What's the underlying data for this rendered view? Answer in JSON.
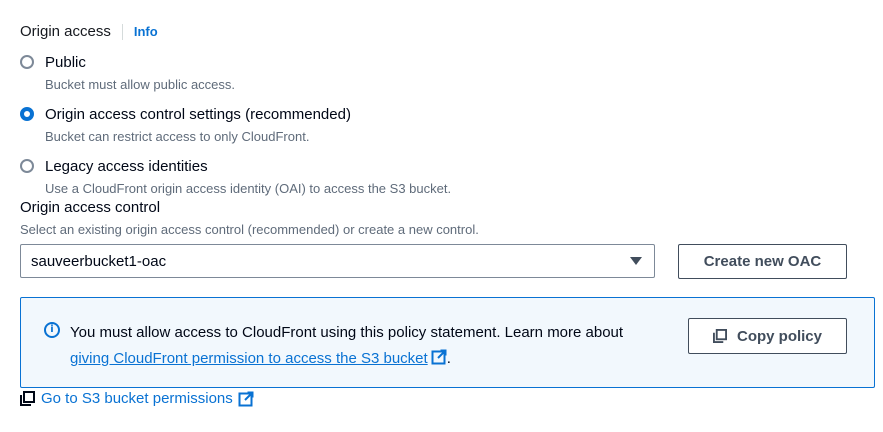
{
  "origin_access": {
    "title": "Origin access",
    "info_label": "Info",
    "options": [
      {
        "label": "Public",
        "description": "Bucket must allow public access.",
        "checked": false
      },
      {
        "label": "Origin access control settings (recommended)",
        "description": "Bucket can restrict access to only CloudFront.",
        "checked": true
      },
      {
        "label": "Legacy access identities",
        "description": "Use a CloudFront origin access identity (OAI) to access the S3 bucket.",
        "checked": false
      }
    ]
  },
  "origin_access_control": {
    "label": "Origin access control",
    "description": "Select an existing origin access control (recommended) or create a new control.",
    "selected_value": "sauveerbucket1-oac",
    "create_button_label": "Create new OAC"
  },
  "policy_alert": {
    "message": "You must allow access to CloudFront using this policy statement. Learn more about",
    "link_text": "giving CloudFront permission to access the S3 bucket",
    "trailing": ".",
    "copy_button_label": "Copy policy"
  },
  "permissions_link": {
    "label": "Go to S3 bucket permissions"
  },
  "colors": {
    "accent": "#0972d3",
    "alert_background": "#f2f8fd",
    "secondary_text": "#5f6b7a"
  }
}
